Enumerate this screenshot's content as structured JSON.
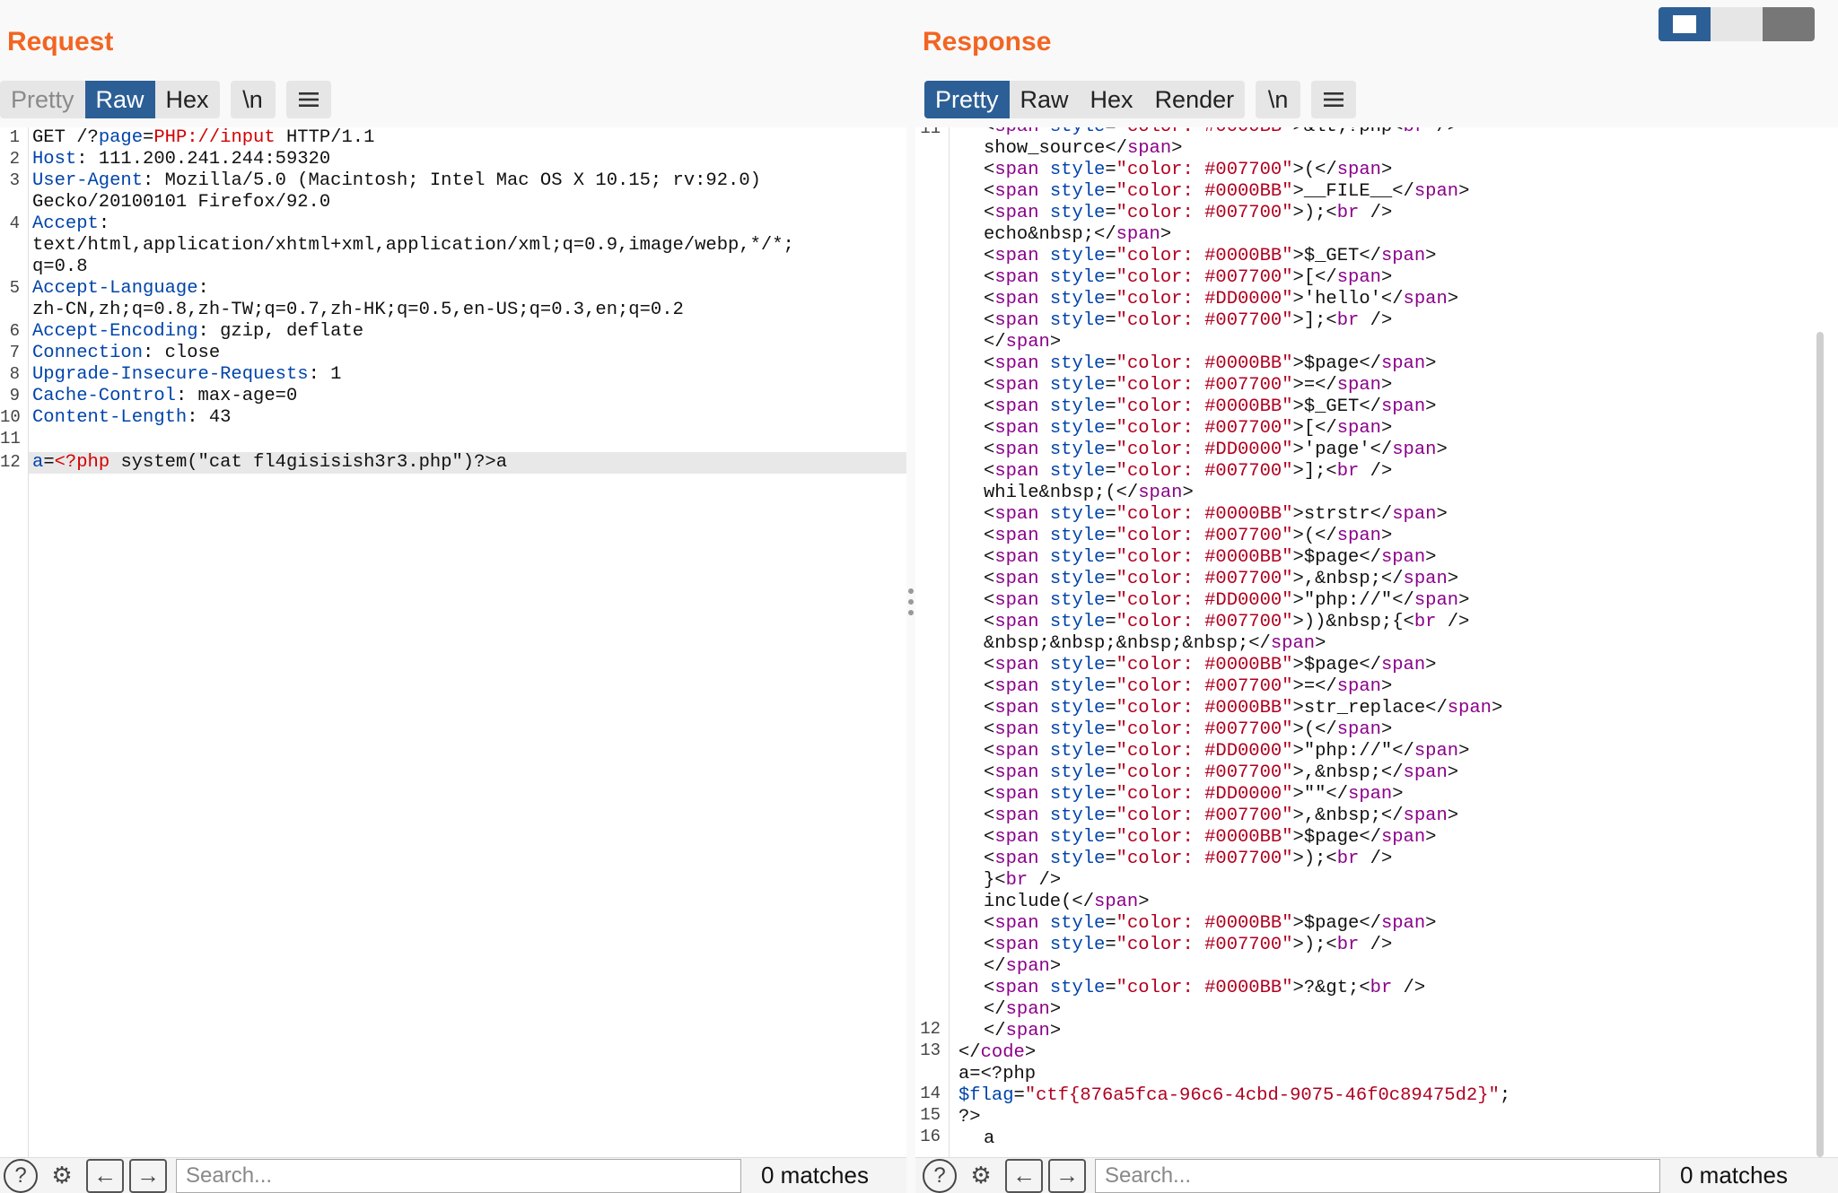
{
  "request": {
    "title": "Request",
    "tabs": [
      {
        "label": "Pretty",
        "active": false
      },
      {
        "label": "Raw",
        "active": true
      },
      {
        "label": "Hex",
        "active": false
      }
    ],
    "newline_label": "\\n",
    "menu_icon": "hamburger-menu-icon",
    "line_numbers": [
      "1",
      "2",
      "3",
      "",
      "4",
      "",
      "",
      "5",
      "",
      "6",
      "7",
      "8",
      "9",
      "10",
      "11",
      "12"
    ],
    "search_placeholder": "Search...",
    "matches": "0 matches"
  },
  "response": {
    "title": "Response",
    "tabs": [
      {
        "label": "Pretty",
        "active": true
      },
      {
        "label": "Raw",
        "active": false
      },
      {
        "label": "Hex",
        "active": false
      },
      {
        "label": "Render",
        "active": false
      }
    ],
    "newline_label": "\\n",
    "menu_icon": "hamburger-menu-icon",
    "top_line_number": "11",
    "search_placeholder": "Search...",
    "matches": "0 matches"
  },
  "layout_toggle": [
    "split-view-icon",
    "stacked-view-icon",
    "single-view-icon"
  ],
  "colors": {
    "accent": "#f26522",
    "active_tab": "#2c5f96"
  }
}
